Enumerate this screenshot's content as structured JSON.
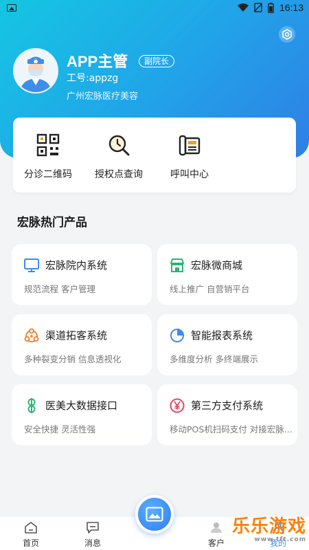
{
  "status_bar": {
    "time": "16:13",
    "battery": ""
  },
  "profile": {
    "name": "APP主管",
    "role_badge": "副院长",
    "employee_id": "工号:appzg",
    "company": "广州宏脉医疗美容"
  },
  "quick_actions": [
    {
      "label": "分诊二维码",
      "icon": "qr-code-icon"
    },
    {
      "label": "授权点查询",
      "icon": "search-clock-icon"
    },
    {
      "label": "呼叫中心",
      "icon": "phone-icon"
    }
  ],
  "section_title": "宏脉热门产品",
  "products": [
    {
      "title": "宏脉院内系统",
      "subtitle": "规范流程 客户管理",
      "icon": "monitor-icon",
      "color": "#3b8cf0"
    },
    {
      "title": "宏脉微商城",
      "subtitle": "线上推广 自营销平台",
      "icon": "shop-icon",
      "color": "#2bb673"
    },
    {
      "title": "渠道拓客系统",
      "subtitle": "多种裂变分销 信息透视化",
      "icon": "network-icon",
      "color": "#f07a1e"
    },
    {
      "title": "智能报表系统",
      "subtitle": "多维度分析 多终端展示",
      "icon": "pie-chart-icon",
      "color": "#3b8cf0"
    },
    {
      "title": "医美大数据接口",
      "subtitle": "安全快捷 灵活性强",
      "icon": "dollar-icon",
      "color": "#2bb673"
    },
    {
      "title": "第三方支付系统",
      "subtitle": "移动POS机扫码支付 对接宏脉...",
      "icon": "yen-icon",
      "color": "#e8455a"
    }
  ],
  "bottom_nav": [
    {
      "label": "首页",
      "icon": "home-icon"
    },
    {
      "label": "消息",
      "icon": "message-icon"
    },
    {
      "label": "客户",
      "icon": "customer-icon"
    },
    {
      "label": "我的",
      "icon": "profile-icon"
    }
  ],
  "watermark": {
    "text": "乐乐游戏",
    "url": "www.tft.com"
  }
}
